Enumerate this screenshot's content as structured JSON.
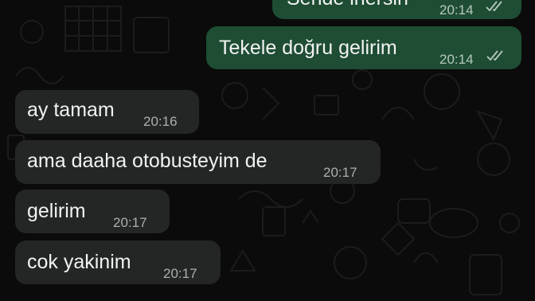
{
  "chat": {
    "messages": [
      {
        "direction": "outgoing",
        "text": "Sende inersin",
        "time": "20:14",
        "status": "read"
      },
      {
        "direction": "outgoing",
        "text": "Tekele doğru gelirim",
        "time": "20:14",
        "status": "read"
      },
      {
        "direction": "incoming",
        "text": "ay tamam",
        "time": "20:16"
      },
      {
        "direction": "incoming",
        "text": "ama daaha otobusteyim de",
        "time": "20:17"
      },
      {
        "direction": "incoming",
        "text": "gelirim",
        "time": "20:17"
      },
      {
        "direction": "incoming",
        "text": "cok yakinim",
        "time": "20:17"
      }
    ]
  },
  "colors": {
    "background": "#0b0b0b",
    "incoming_bubble": "#242626",
    "outgoing_bubble": "#1e4d34",
    "read_ticks": "#b7c9bd"
  }
}
